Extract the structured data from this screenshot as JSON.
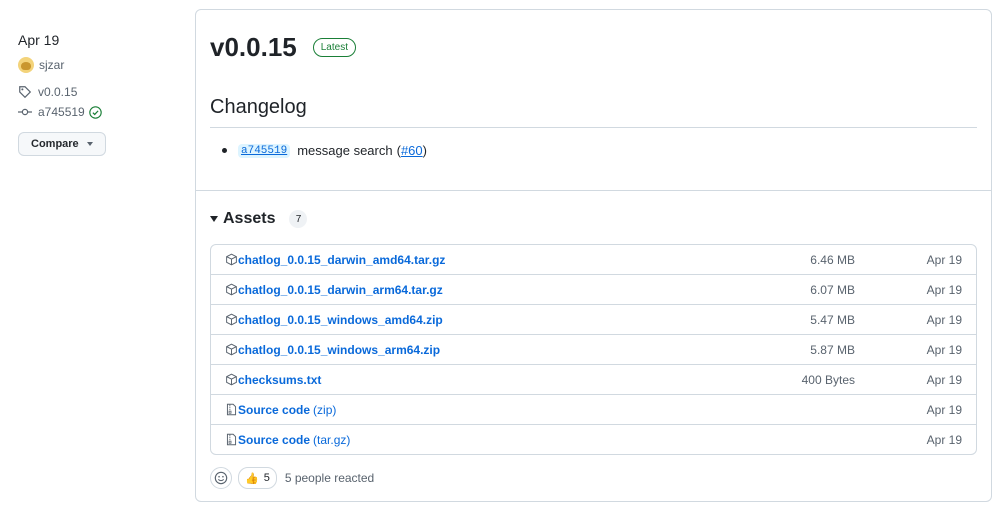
{
  "sidebar": {
    "date": "Apr 19",
    "author": "sjzar",
    "tag": "v0.0.15",
    "commit": "a745519",
    "compare_label": "Compare"
  },
  "release": {
    "title": "v0.0.15",
    "badge": "Latest",
    "changelog_heading": "Changelog",
    "changes": [
      {
        "commit": "a745519",
        "text": "message search",
        "pr_open": "(",
        "pr": "#60",
        "pr_close": ")"
      }
    ]
  },
  "assets": {
    "heading": "Assets",
    "count": "7",
    "items": [
      {
        "name": "chatlog_0.0.15_darwin_amd64.tar.gz",
        "suffix": "",
        "size": "6.46 MB",
        "date": "Apr 19",
        "icon": "package-icon"
      },
      {
        "name": "chatlog_0.0.15_darwin_arm64.tar.gz",
        "suffix": "",
        "size": "6.07 MB",
        "date": "Apr 19",
        "icon": "package-icon"
      },
      {
        "name": "chatlog_0.0.15_windows_amd64.zip",
        "suffix": "",
        "size": "5.47 MB",
        "date": "Apr 19",
        "icon": "package-icon"
      },
      {
        "name": "chatlog_0.0.15_windows_arm64.zip",
        "suffix": "",
        "size": "5.87 MB",
        "date": "Apr 19",
        "icon": "package-icon"
      },
      {
        "name": "checksums.txt",
        "suffix": "",
        "size": "400 Bytes",
        "date": "Apr 19",
        "icon": "package-icon"
      },
      {
        "name": "Source code",
        "suffix": "(zip)",
        "size": "",
        "date": "Apr 19",
        "icon": "file-zip-icon"
      },
      {
        "name": "Source code",
        "suffix": "(tar.gz)",
        "size": "",
        "date": "Apr 19",
        "icon": "file-zip-icon"
      }
    ]
  },
  "reactions": {
    "emoji": "👍",
    "count": "5",
    "summary": "5 people reacted"
  },
  "colors": {
    "link": "#0969da",
    "latest_green": "#1a7f37",
    "border": "#d1d9e0",
    "muted": "#59636e"
  }
}
